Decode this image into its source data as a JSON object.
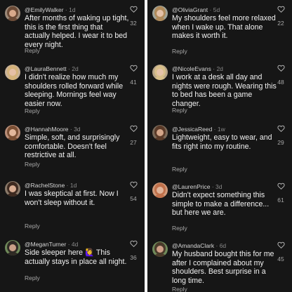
{
  "left_column": [
    {
      "handle": "@EmilyWalker",
      "time": "1d",
      "text": "After months of waking up tight, this is the first thing that actually helped. I wear it to bed every night.",
      "reply_label": "Reply",
      "likes": "32",
      "avatar": {
        "skin": "#d8a98c",
        "hair": "#6b4a36",
        "bg": "#9c8a7a"
      }
    },
    {
      "handle": "@LauraBennett",
      "time": "2d",
      "text": "I didn't realize how much my shoulders rolled forward while sleeping. Mornings feel way easier now.",
      "reply_label": "Reply",
      "likes": "41",
      "avatar": {
        "skin": "#e6c0a6",
        "hair": "#d4b27a",
        "bg": "#c9b39a"
      }
    },
    {
      "handle": "@HannahMoore",
      "time": "3d",
      "text": "Simple, soft, and surprisingly comfortable. Doesn't feel restrictive at all.",
      "reply_label": "Reply",
      "likes": "27",
      "avatar": {
        "skin": "#e2b79c",
        "hair": "#7a4f34",
        "bg": "#b98e78"
      }
    },
    {
      "handle": "@RachelStone",
      "time": "1d",
      "text": "I was skeptical at first. Now I won't sleep without it.",
      "reply_label": "Reply",
      "likes": "54",
      "avatar": {
        "skin": "#d9ad92",
        "hair": "#3e2a20",
        "bg": "#8a7a6a"
      }
    },
    {
      "handle": "@MeganTurner",
      "time": "4d",
      "text": "Side sleeper here 🙋‍♀️ This actually stays in place all night.",
      "reply_label": "Reply",
      "likes": "36",
      "avatar": {
        "skin": "#c9a088",
        "hair": "#2f2a24",
        "bg": "#6f8a5a"
      }
    }
  ],
  "right_column": [
    {
      "handle": "@OliviaGrant",
      "time": "5d",
      "text": "My shoulders feel more relaxed when I wake up. That alone makes it worth it.",
      "reply_label": "Reply",
      "likes": "22",
      "avatar": {
        "skin": "#e4c1a8",
        "hair": "#b08a5a",
        "bg": "#a0a49a"
      }
    },
    {
      "handle": "@NicoleEvans",
      "time": "2d",
      "text": "I work at a desk all day and nights were rough. Wearing this to bed has been a game changer.",
      "reply_label": "Reply",
      "likes": "48",
      "avatar": {
        "skin": "#e6c3aa",
        "hair": "#d8bf8a",
        "bg": "#b7a58a"
      }
    },
    {
      "handle": "@JessicaReed",
      "time": "1w",
      "text": "Lightweight, easy to wear, and fits right into my routine.",
      "reply_label": "Reply",
      "likes": "29",
      "avatar": {
        "skin": "#d4a68a",
        "hair": "#5a3a28",
        "bg": "#7a6a5a"
      }
    },
    {
      "handle": "@LaurenPrice",
      "time": "3d",
      "text": "Didn't expect something this simple to make a difference... but here we are.",
      "reply_label": "Reply",
      "likes": "61",
      "avatar": {
        "skin": "#e0b49a",
        "hair": "#c0704a",
        "bg": "#cf9a7a"
      }
    },
    {
      "handle": "@AmandaClark",
      "time": "6d",
      "text": "My husband bought this for me after I complained about my shoulders. Best surprise in a long time.",
      "reply_label": "Reply",
      "likes": "45",
      "avatar": {
        "skin": "#cfa088",
        "hair": "#4a3a2a",
        "bg": "#6f8a5a"
      }
    }
  ],
  "colors": {
    "background": "#161616",
    "handle_text": "#d6d6d6",
    "time_text": "#8a8a8a",
    "body_text": "#f2f2f2",
    "muted_text": "#a8a8a8",
    "divider": "#ffffff"
  },
  "icons": {
    "like": "heart-outline-icon"
  }
}
